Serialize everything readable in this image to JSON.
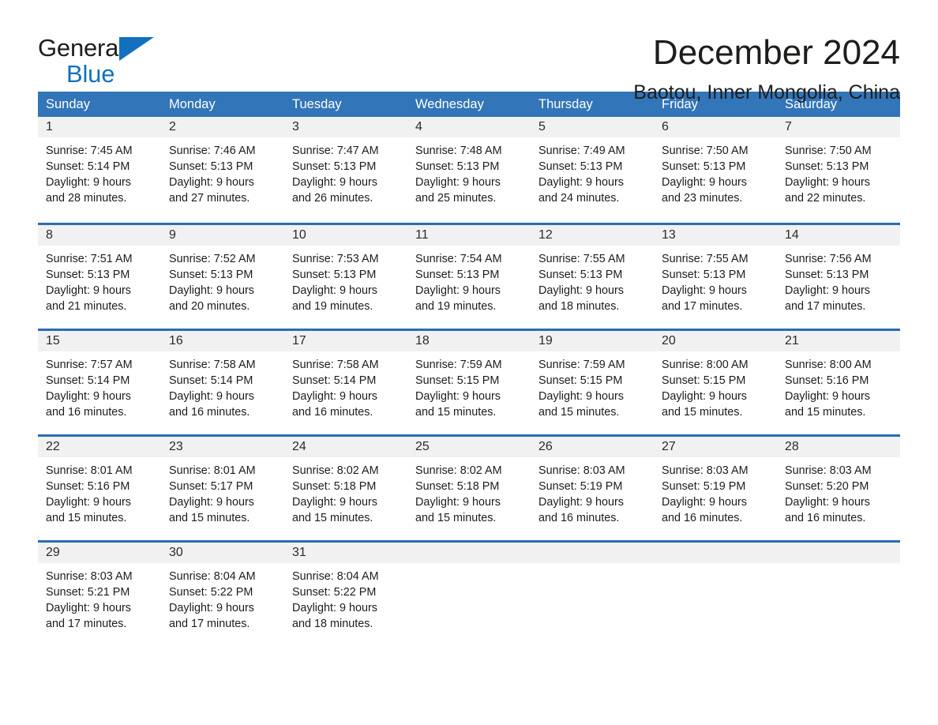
{
  "brand": {
    "line1": "General",
    "line2": "Blue",
    "logo_icon": "blue-triangle-icon"
  },
  "header": {
    "month_title": "December 2024",
    "location": "Baotou, Inner Mongolia, China"
  },
  "theme": {
    "header_blue": "#3275b8",
    "row_border_blue": "#2a6db3",
    "day_band_gray": "#f1f1f1",
    "brand_blue": "#1270bf",
    "text_dark": "#1d1d1b"
  },
  "weekdays": [
    "Sunday",
    "Monday",
    "Tuesday",
    "Wednesday",
    "Thursday",
    "Friday",
    "Saturday"
  ],
  "weeks": [
    [
      {
        "day": "1",
        "sunrise": "Sunrise: 7:45 AM",
        "sunset": "Sunset: 5:14 PM",
        "daylight1": "Daylight: 9 hours",
        "daylight2": "and 28 minutes."
      },
      {
        "day": "2",
        "sunrise": "Sunrise: 7:46 AM",
        "sunset": "Sunset: 5:13 PM",
        "daylight1": "Daylight: 9 hours",
        "daylight2": "and 27 minutes."
      },
      {
        "day": "3",
        "sunrise": "Sunrise: 7:47 AM",
        "sunset": "Sunset: 5:13 PM",
        "daylight1": "Daylight: 9 hours",
        "daylight2": "and 26 minutes."
      },
      {
        "day": "4",
        "sunrise": "Sunrise: 7:48 AM",
        "sunset": "Sunset: 5:13 PM",
        "daylight1": "Daylight: 9 hours",
        "daylight2": "and 25 minutes."
      },
      {
        "day": "5",
        "sunrise": "Sunrise: 7:49 AM",
        "sunset": "Sunset: 5:13 PM",
        "daylight1": "Daylight: 9 hours",
        "daylight2": "and 24 minutes."
      },
      {
        "day": "6",
        "sunrise": "Sunrise: 7:50 AM",
        "sunset": "Sunset: 5:13 PM",
        "daylight1": "Daylight: 9 hours",
        "daylight2": "and 23 minutes."
      },
      {
        "day": "7",
        "sunrise": "Sunrise: 7:50 AM",
        "sunset": "Sunset: 5:13 PM",
        "daylight1": "Daylight: 9 hours",
        "daylight2": "and 22 minutes."
      }
    ],
    [
      {
        "day": "8",
        "sunrise": "Sunrise: 7:51 AM",
        "sunset": "Sunset: 5:13 PM",
        "daylight1": "Daylight: 9 hours",
        "daylight2": "and 21 minutes."
      },
      {
        "day": "9",
        "sunrise": "Sunrise: 7:52 AM",
        "sunset": "Sunset: 5:13 PM",
        "daylight1": "Daylight: 9 hours",
        "daylight2": "and 20 minutes."
      },
      {
        "day": "10",
        "sunrise": "Sunrise: 7:53 AM",
        "sunset": "Sunset: 5:13 PM",
        "daylight1": "Daylight: 9 hours",
        "daylight2": "and 19 minutes."
      },
      {
        "day": "11",
        "sunrise": "Sunrise: 7:54 AM",
        "sunset": "Sunset: 5:13 PM",
        "daylight1": "Daylight: 9 hours",
        "daylight2": "and 19 minutes."
      },
      {
        "day": "12",
        "sunrise": "Sunrise: 7:55 AM",
        "sunset": "Sunset: 5:13 PM",
        "daylight1": "Daylight: 9 hours",
        "daylight2": "and 18 minutes."
      },
      {
        "day": "13",
        "sunrise": "Sunrise: 7:55 AM",
        "sunset": "Sunset: 5:13 PM",
        "daylight1": "Daylight: 9 hours",
        "daylight2": "and 17 minutes."
      },
      {
        "day": "14",
        "sunrise": "Sunrise: 7:56 AM",
        "sunset": "Sunset: 5:13 PM",
        "daylight1": "Daylight: 9 hours",
        "daylight2": "and 17 minutes."
      }
    ],
    [
      {
        "day": "15",
        "sunrise": "Sunrise: 7:57 AM",
        "sunset": "Sunset: 5:14 PM",
        "daylight1": "Daylight: 9 hours",
        "daylight2": "and 16 minutes."
      },
      {
        "day": "16",
        "sunrise": "Sunrise: 7:58 AM",
        "sunset": "Sunset: 5:14 PM",
        "daylight1": "Daylight: 9 hours",
        "daylight2": "and 16 minutes."
      },
      {
        "day": "17",
        "sunrise": "Sunrise: 7:58 AM",
        "sunset": "Sunset: 5:14 PM",
        "daylight1": "Daylight: 9 hours",
        "daylight2": "and 16 minutes."
      },
      {
        "day": "18",
        "sunrise": "Sunrise: 7:59 AM",
        "sunset": "Sunset: 5:15 PM",
        "daylight1": "Daylight: 9 hours",
        "daylight2": "and 15 minutes."
      },
      {
        "day": "19",
        "sunrise": "Sunrise: 7:59 AM",
        "sunset": "Sunset: 5:15 PM",
        "daylight1": "Daylight: 9 hours",
        "daylight2": "and 15 minutes."
      },
      {
        "day": "20",
        "sunrise": "Sunrise: 8:00 AM",
        "sunset": "Sunset: 5:15 PM",
        "daylight1": "Daylight: 9 hours",
        "daylight2": "and 15 minutes."
      },
      {
        "day": "21",
        "sunrise": "Sunrise: 8:00 AM",
        "sunset": "Sunset: 5:16 PM",
        "daylight1": "Daylight: 9 hours",
        "daylight2": "and 15 minutes."
      }
    ],
    [
      {
        "day": "22",
        "sunrise": "Sunrise: 8:01 AM",
        "sunset": "Sunset: 5:16 PM",
        "daylight1": "Daylight: 9 hours",
        "daylight2": "and 15 minutes."
      },
      {
        "day": "23",
        "sunrise": "Sunrise: 8:01 AM",
        "sunset": "Sunset: 5:17 PM",
        "daylight1": "Daylight: 9 hours",
        "daylight2": "and 15 minutes."
      },
      {
        "day": "24",
        "sunrise": "Sunrise: 8:02 AM",
        "sunset": "Sunset: 5:18 PM",
        "daylight1": "Daylight: 9 hours",
        "daylight2": "and 15 minutes."
      },
      {
        "day": "25",
        "sunrise": "Sunrise: 8:02 AM",
        "sunset": "Sunset: 5:18 PM",
        "daylight1": "Daylight: 9 hours",
        "daylight2": "and 15 minutes."
      },
      {
        "day": "26",
        "sunrise": "Sunrise: 8:03 AM",
        "sunset": "Sunset: 5:19 PM",
        "daylight1": "Daylight: 9 hours",
        "daylight2": "and 16 minutes."
      },
      {
        "day": "27",
        "sunrise": "Sunrise: 8:03 AM",
        "sunset": "Sunset: 5:19 PM",
        "daylight1": "Daylight: 9 hours",
        "daylight2": "and 16 minutes."
      },
      {
        "day": "28",
        "sunrise": "Sunrise: 8:03 AM",
        "sunset": "Sunset: 5:20 PM",
        "daylight1": "Daylight: 9 hours",
        "daylight2": "and 16 minutes."
      }
    ],
    [
      {
        "day": "29",
        "sunrise": "Sunrise: 8:03 AM",
        "sunset": "Sunset: 5:21 PM",
        "daylight1": "Daylight: 9 hours",
        "daylight2": "and 17 minutes."
      },
      {
        "day": "30",
        "sunrise": "Sunrise: 8:04 AM",
        "sunset": "Sunset: 5:22 PM",
        "daylight1": "Daylight: 9 hours",
        "daylight2": "and 17 minutes."
      },
      {
        "day": "31",
        "sunrise": "Sunrise: 8:04 AM",
        "sunset": "Sunset: 5:22 PM",
        "daylight1": "Daylight: 9 hours",
        "daylight2": "and 18 minutes."
      },
      {
        "day": "",
        "sunrise": "",
        "sunset": "",
        "daylight1": "",
        "daylight2": ""
      },
      {
        "day": "",
        "sunrise": "",
        "sunset": "",
        "daylight1": "",
        "daylight2": ""
      },
      {
        "day": "",
        "sunrise": "",
        "sunset": "",
        "daylight1": "",
        "daylight2": ""
      },
      {
        "day": "",
        "sunrise": "",
        "sunset": "",
        "daylight1": "",
        "daylight2": ""
      }
    ]
  ]
}
